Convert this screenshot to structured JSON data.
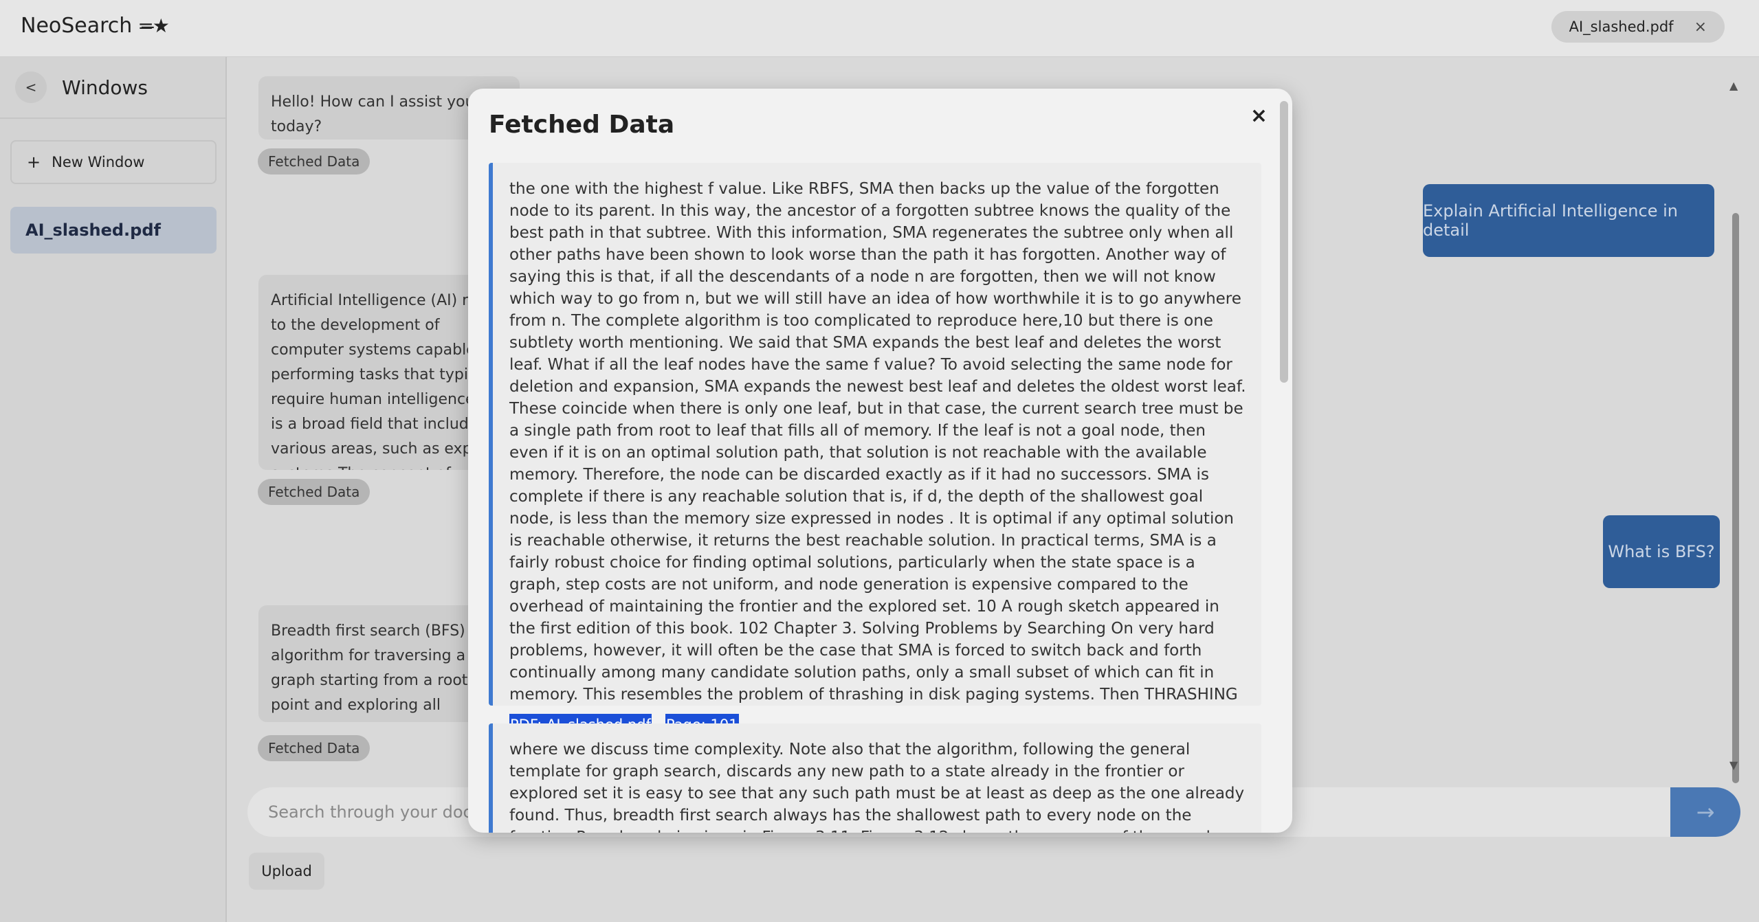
{
  "app": {
    "title": "NeoSearch",
    "logo": "=̶★"
  },
  "tabs": [
    {
      "label": "AI_slashed.pdf",
      "close": "×"
    }
  ],
  "sidebar": {
    "back": "<",
    "title": "Windows",
    "new_window": "New Window",
    "new_window_icon": "+",
    "items": [
      {
        "label": "AI_slashed.pdf"
      }
    ]
  },
  "chat": {
    "messages": [
      {
        "role": "assistant",
        "text": "Hello! How can I assist you today?"
      },
      {
        "role": "user",
        "text": "Explain Artificial Intelligence in detail"
      },
      {
        "role": "assistant",
        "text": "Artificial Intelligence (AI) refers to the development of computer systems capable of performing tasks that typically require human intelligence. AI is a broad field that includes various areas, such as expert systems The concept of artificial intelligence has long fascinated philosophers studying the nature of intelligence and how it emerges, leading to the development of theories and models that..."
      },
      {
        "role": "user",
        "text": "What is BFS?"
      },
      {
        "role": "assistant",
        "text": "Breadth first search (BFS) is an algorithm for traversing a graph starting from a root point and exploring all adjacent nodes at the present depth and is commonly used in applications..."
      }
    ],
    "fetched_label": "Fetched Data",
    "search_placeholder": "Search through your documents...",
    "send_icon": "→",
    "upload_label": "Upload"
  },
  "modal": {
    "title": "Fetched Data",
    "close": "×",
    "entries": [
      {
        "text": "the one with the highest f value. Like RBFS, SMA then backs up the value of the forgotten node to its parent. In this way, the ancestor of a forgotten subtree knows the quality of the best path in that subtree. With this information, SMA regenerates the subtree only when all other paths have been shown to look worse than the path it has forgotten. Another way of saying this is that, if all the descendants of a node n are forgotten, then we will not know which way to go from n, but we will still have an idea of how worthwhile it is to go anywhere from n. The complete algorithm is too complicated to reproduce here,10 but there is one subtlety worth mentioning. We said that SMA expands the best leaf and deletes the worst leaf. What if all the leaf nodes have the same f value? To avoid selecting the same node for deletion and expansion, SMA expands the newest best leaf and deletes the oldest worst leaf. These coincide when there is only one leaf, but in that case, the current search tree must be a single path from root to leaf that fills all of memory. If the leaf is not a goal node, then even if it is on an optimal solution path, that solution is not reachable with the available memory. Therefore, the node can be discarded exactly as if it had no successors. SMA is complete if there is any reachable solution that is, if d, the depth of the shallowest goal node, is less than the memory size expressed in nodes . It is optimal if any optimal solution is reachable otherwise, it returns the best reachable solution. In practical terms, SMA is a fairly robust choice for finding optimal solutions, particularly when the state space is a graph, step costs are not uniform, and node generation is expensive compared to the overhead of maintaining the frontier and the explored set. 10 A rough sketch appeared in the first edition of this book. 102 Chapter 3. Solving Problems by Searching On very hard problems, however, it will often be the case that SMA is forced to switch back and forth continually among many candidate solution paths, only a small subset of which can fit in memory. This resembles the problem of thrashing in disk paging systems. Then THRASHING",
        "pdf": "PDF: AI_slashed.pdf",
        "page": "Page: 101"
      },
      {
        "text": "where we discuss time complexity. Note also that the algorithm, following the general template for graph search, discards any new path to a state already in the frontier or explored set it is easy to see that any such path must be at least as deep as the one already found. Thus, breadth first search always has the shallowest path to every node on the frontier. Pseudocode is given in Figure 3.11. Figure 3.12 shows the progress of the search on a simple binary tree. How about breadth first search",
        "pdf": "",
        "page": ""
      }
    ]
  }
}
